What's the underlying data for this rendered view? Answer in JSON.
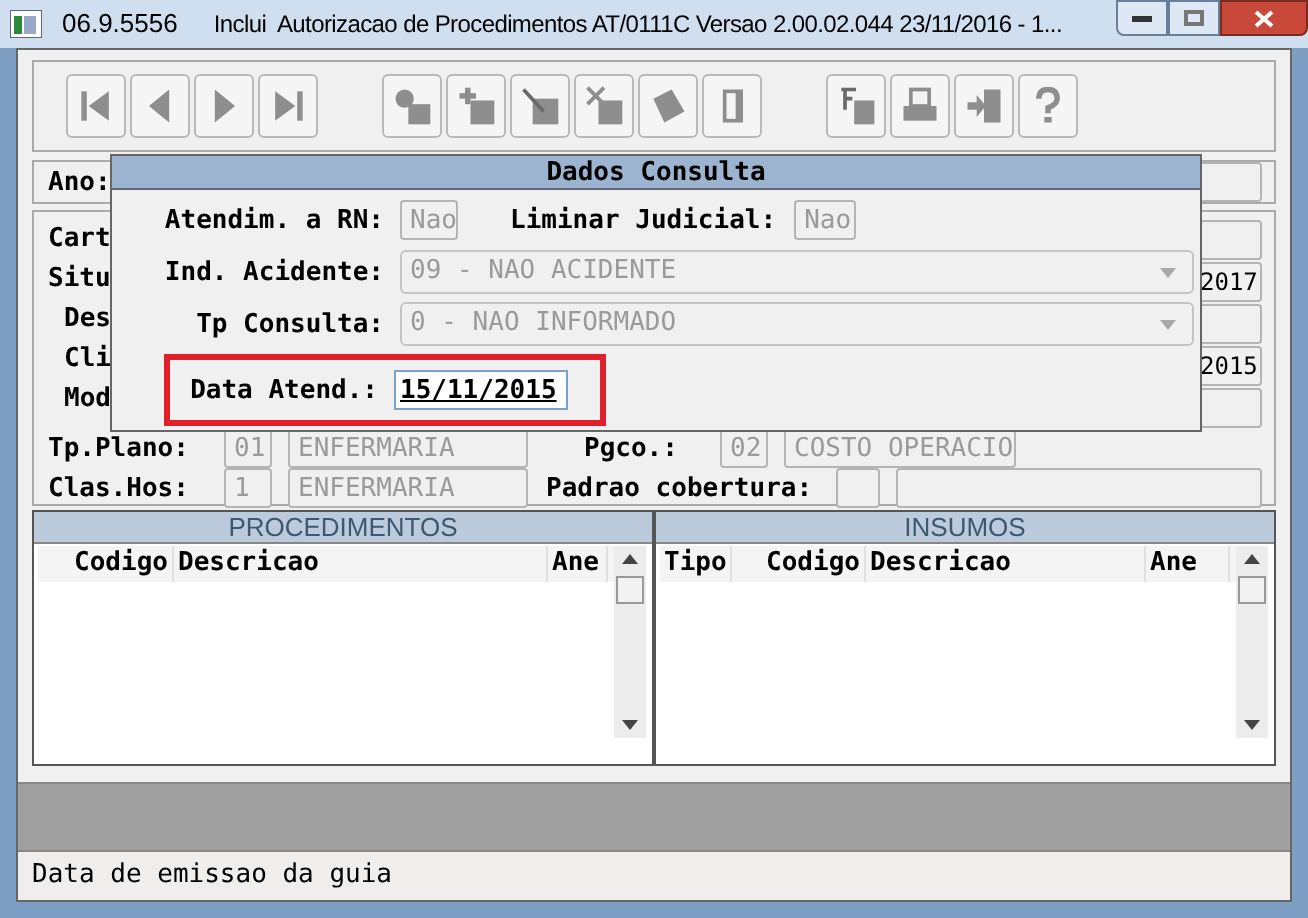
{
  "window": {
    "code": "06.9.5556",
    "title": "Inclui  Autorizacao de Procedimentos AT/0111C Versao 2.00.02.044 23/11/2016 - 1..."
  },
  "form": {
    "ano_label": "Ano:",
    "side_labels": [
      "Cart",
      "Situ",
      "Des",
      "Cli",
      "Mod"
    ],
    "clipped_values": [
      "2017",
      "2015"
    ],
    "plano_row": {
      "label": "Tp.Plano:",
      "code": "01",
      "name": "ENFERMARIA",
      "pgco_label": "Pgco.:",
      "pgco_code": "02",
      "pgco_name": "COSTO OPERACIO"
    },
    "clas_row": {
      "label": "Clas.Hos:",
      "code": "1",
      "name": "ENFERMARIA",
      "padrao_label": "Padrao cobertura:"
    }
  },
  "dialog": {
    "title": "Dados Consulta",
    "atendim_rn": {
      "label": "Atendim. a RN:",
      "value": "Nao",
      "disabled": true
    },
    "liminar": {
      "label": "Liminar Judicial:",
      "value": "Nao",
      "disabled": true
    },
    "ind_acidente": {
      "label": "Ind. Acidente:",
      "value": "09 - NAO ACIDENTE",
      "disabled": true
    },
    "tp_consulta": {
      "label": "Tp Consulta:",
      "value": "0 - NAO INFORMADO",
      "disabled": true
    },
    "data_atend": {
      "label": "Data Atend.:",
      "value": "15/11/2015",
      "highlighted": true
    }
  },
  "grids": [
    {
      "title": "PROCEDIMENTOS",
      "columns": [
        "Codigo",
        "Descricao",
        "Ane"
      ]
    },
    {
      "title": "INSUMOS",
      "columns": [
        "Tipo",
        "Codigo",
        "Descricao",
        "Ane"
      ]
    }
  ],
  "status_bar": "Data de emissao da guia"
}
